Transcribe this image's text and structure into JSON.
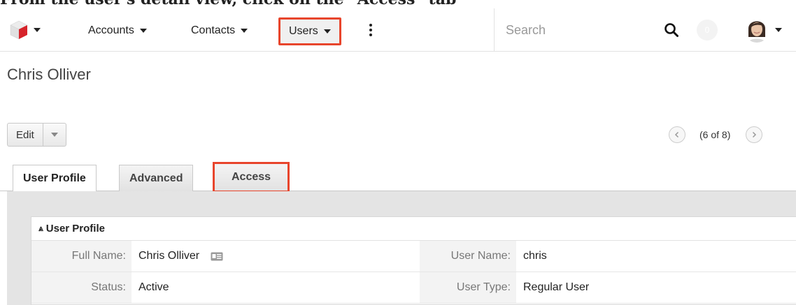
{
  "caption": "From the user's detail view, click on the \"Access\" tab",
  "nav": {
    "menus": [
      "Accounts",
      "Contacts",
      "Users"
    ],
    "search_placeholder": "Search",
    "notification_count": "0"
  },
  "record": {
    "title": "Chris Olliver",
    "edit_label": "Edit",
    "pager_text": "(6 of 8)"
  },
  "tabs": [
    "User Profile",
    "Advanced",
    "Access"
  ],
  "panel": {
    "header": "User Profile",
    "rows": [
      {
        "label1": "Full Name:",
        "value1": "Chris Olliver",
        "label2": "User Name:",
        "value2": "chris"
      },
      {
        "label1": "Status:",
        "value1": "Active",
        "label2": "User Type:",
        "value2": "Regular User"
      }
    ]
  },
  "colors": {
    "highlight": "#e8452c",
    "logo_red": "#d6232a"
  }
}
